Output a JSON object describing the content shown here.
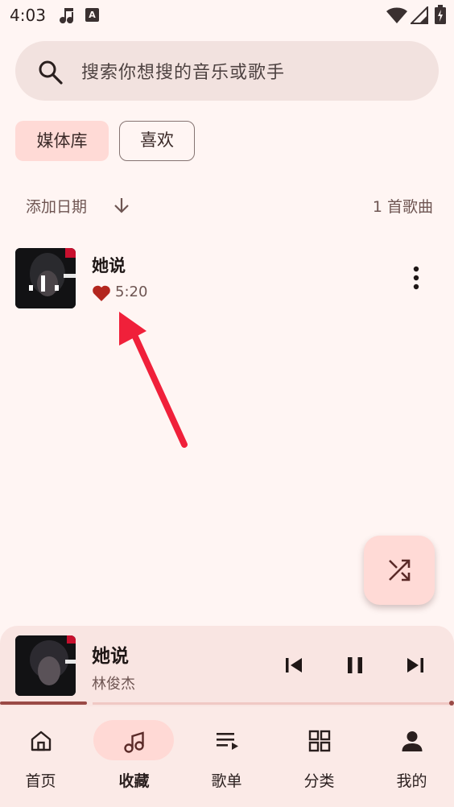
{
  "status_bar": {
    "time": "4:03",
    "a_label": "A"
  },
  "search": {
    "placeholder": "搜索你想搜的音乐或歌手"
  },
  "chips": {
    "library": "媒体库",
    "favorites": "喜欢"
  },
  "sort": {
    "label": "添加日期",
    "count": "1 首歌曲"
  },
  "songs": [
    {
      "title": "她说",
      "duration": "5:20",
      "liked": true
    }
  ],
  "player": {
    "title": "她说",
    "artist": "林俊杰",
    "progress": 0.18
  },
  "nav": [
    {
      "label": "首页",
      "icon": "home-icon"
    },
    {
      "label": "收藏",
      "icon": "music-note-icon",
      "active": true
    },
    {
      "label": "歌单",
      "icon": "playlist-icon"
    },
    {
      "label": "分类",
      "icon": "grid-icon"
    },
    {
      "label": "我的",
      "icon": "person-icon"
    }
  ],
  "colors": {
    "accent": "#ffdad6",
    "background": "#fff5f3",
    "heart": "#b3261e",
    "annotation": "#f0203a"
  }
}
